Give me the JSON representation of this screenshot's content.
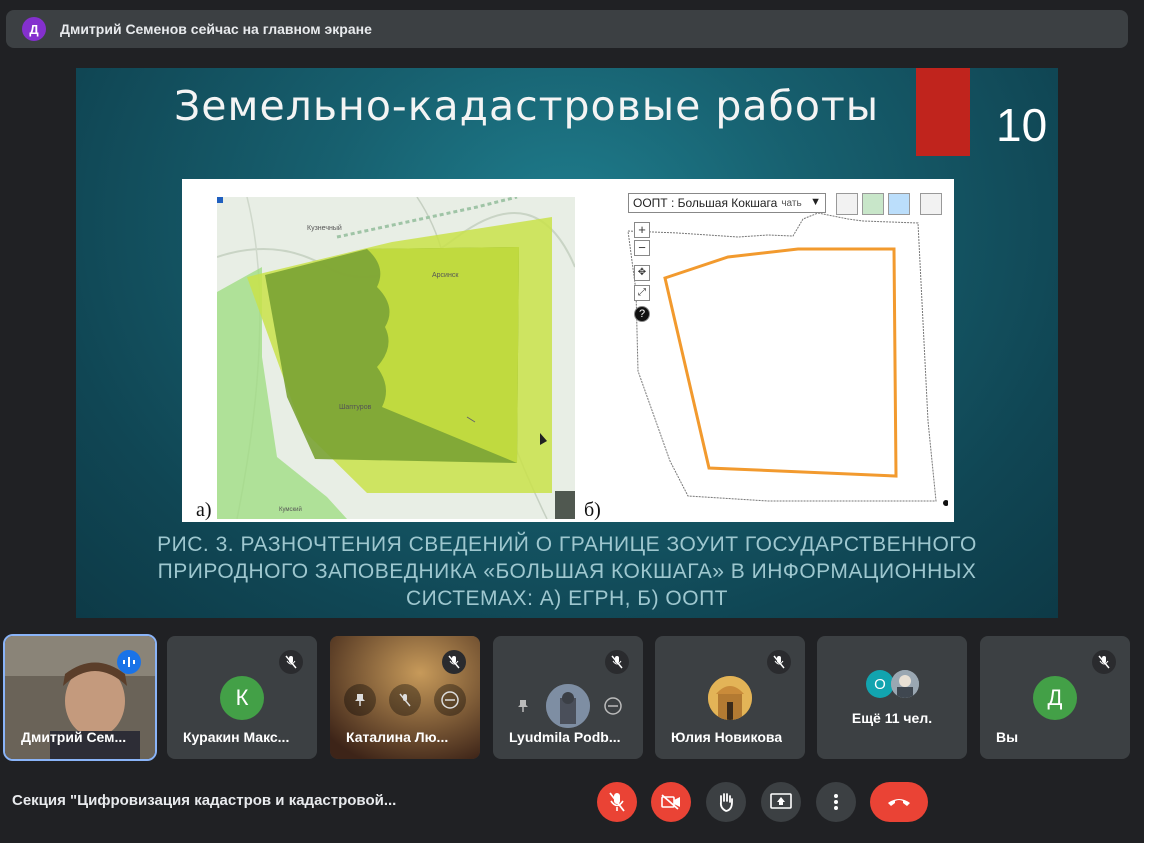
{
  "banner": {
    "avatar_letter": "Д",
    "text": "Дмитрий Семенов сейчас на главном экране"
  },
  "slide": {
    "title": "Земельно-кадастровые работы",
    "number": "10",
    "label_a": "а)",
    "label_b": "б)",
    "map_select": "ООПТ : Большая Кокшага",
    "map_select_overflow": "чать",
    "map_places": [
      "Кузнечный",
      "Арсинск",
      "Шаптуров",
      "Кумский"
    ],
    "caption_lines": [
      "РИС. 3. РАЗНОЧТЕНИЯ СВЕДЕНИЙ О ГРАНИЦЕ ЗОУИТ ГОСУДАРСТВЕННОГО",
      "ПРИРОДНОГО ЗАПОВЕДНИКА «БОЛЬШАЯ КОКШАГА» В ИНФОРМАЦИОННЫХ",
      "СИСТЕМАХ: А) ЕГРН, Б) ООПТ"
    ],
    "zoom_in": "+",
    "zoom_out": "−"
  },
  "participants": [
    {
      "name": "Дмитрий Сем...",
      "type": "video"
    },
    {
      "name": "Куракин Макс...",
      "avatar_letter": "К",
      "avatar_color": "#43a047"
    },
    {
      "name": "Каталина Лю...",
      "type": "video"
    },
    {
      "name": "Lyudmila Podb...",
      "type": "photo"
    },
    {
      "name": "Юлия Новикова",
      "type": "photo"
    },
    {
      "name": "Ещё 11 чел.",
      "mini_avatar_letter": "О",
      "mini_avatar_color": "#12a4af"
    },
    {
      "name": "Вы",
      "avatar_letter": "Д",
      "avatar_color": "#43a047"
    }
  ],
  "meeting_title": "Секция \"Цифровизация кадастров и кадастровой...",
  "colors": {
    "accent_red": "#ea4335",
    "tile_bg": "#3c4043",
    "active_outline": "#8ab4f8",
    "slide_red": "#c0241d"
  }
}
